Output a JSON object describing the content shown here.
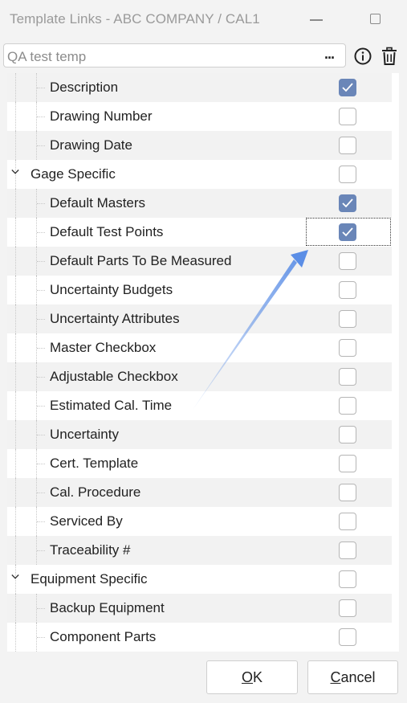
{
  "window": {
    "title": "Template Links - ABC COMPANY / CAL1"
  },
  "template": {
    "value": "QA test temp",
    "browse_label": "...",
    "info_icon": "info-icon",
    "delete_icon": "trash-icon"
  },
  "tree": {
    "rows": [
      {
        "label": "Description",
        "level": 1,
        "checked": true
      },
      {
        "label": "Drawing Number",
        "level": 1,
        "checked": false
      },
      {
        "label": "Drawing Date",
        "level": 1,
        "checked": false
      },
      {
        "label": "Gage Specific",
        "level": 0,
        "checked": false,
        "expanded": true
      },
      {
        "label": "Default Masters",
        "level": 1,
        "checked": true
      },
      {
        "label": "Default Test Points",
        "level": 1,
        "checked": true,
        "focused": true
      },
      {
        "label": "Default Parts To Be Measured",
        "level": 1,
        "checked": false
      },
      {
        "label": "Uncertainty Budgets",
        "level": 1,
        "checked": false
      },
      {
        "label": "Uncertainty Attributes",
        "level": 1,
        "checked": false
      },
      {
        "label": "Master Checkbox",
        "level": 1,
        "checked": false
      },
      {
        "label": "Adjustable Checkbox",
        "level": 1,
        "checked": false
      },
      {
        "label": "Estimated Cal. Time",
        "level": 1,
        "checked": false
      },
      {
        "label": "Uncertainty",
        "level": 1,
        "checked": false
      },
      {
        "label": "Cert. Template",
        "level": 1,
        "checked": false
      },
      {
        "label": "Cal. Procedure",
        "level": 1,
        "checked": false
      },
      {
        "label": "Serviced By",
        "level": 1,
        "checked": false
      },
      {
        "label": "Traceability #",
        "level": 1,
        "checked": false
      },
      {
        "label": "Equipment Specific",
        "level": 0,
        "checked": false,
        "expanded": true
      },
      {
        "label": "Backup Equipment",
        "level": 1,
        "checked": false
      },
      {
        "label": "Component Parts",
        "level": 1,
        "checked": false
      }
    ]
  },
  "buttons": {
    "ok": {
      "mnemonic": "O",
      "rest": "K"
    },
    "cancel": {
      "mnemonic": "C",
      "rest": "ancel"
    }
  },
  "colors": {
    "checkbox_checked": "#6a86b8",
    "annotation_arrow": "#5b8ee6"
  }
}
